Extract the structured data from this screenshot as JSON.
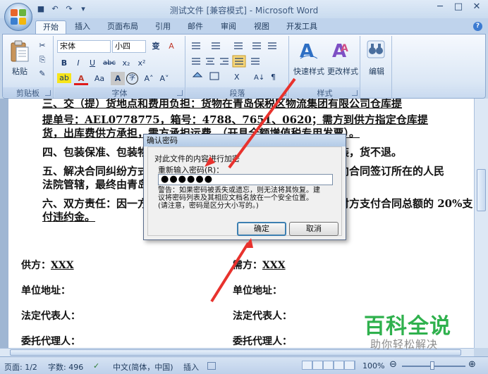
{
  "window": {
    "title": "测试文件 [兼容模式] - Microsoft Word",
    "minimize": "─",
    "maximize": "□",
    "close": "✕"
  },
  "qat": {
    "save": "■",
    "undo": "↶",
    "redo": "↷",
    "customize": "▾"
  },
  "tabs": [
    "开始",
    "插入",
    "页面布局",
    "引用",
    "邮件",
    "审阅",
    "视图",
    "开发工具"
  ],
  "help": "?",
  "ribbon": {
    "clipboard": {
      "label": "剪贴板",
      "paste": "粘贴",
      "cut": "✂",
      "copy": "⎘",
      "format_painter": "✎"
    },
    "font": {
      "label": "字体",
      "name": "宋体",
      "size": "小四",
      "phonetic": "变",
      "clear": "A",
      "bold": "B",
      "italic": "I",
      "underline": "U",
      "strike": "abc",
      "subscript": "x₂",
      "superscript": "x²",
      "change_case": "Aa",
      "highlight": "ab",
      "font_color": "A",
      "char_shade": "A",
      "enclose": "字",
      "grow": "A˄",
      "shrink": "A˅"
    },
    "paragraph": {
      "label": "段落"
    },
    "styles": {
      "label": "样式",
      "quick": "快速样式",
      "change": "更改样式"
    },
    "editing": {
      "label": "编辑"
    }
  },
  "document": {
    "lines": [
      {
        "text": "三、交（提）货地点和费用负担：货物在青岛保税区物流集团有限公司仓库提",
        "underline": true
      },
      {
        "text": "提单号：AEL0778775，箱号：4788、7651、0620；需方到供方指定仓库提",
        "underline": true
      },
      {
        "text": "货，出库费供方承担，需方承担运费。（开具全额增值税专用发票）。",
        "underline": true
      },
      {
        "text": "四、包装保准、包装物的供应与回收：按原产地包装，不另作包装，货不退。",
        "underline": false
      },
      {
        "text": "五、解决合同纠纷方式：双方协商解决，协商不成，任何一方可向合同签订所在的人民",
        "underline": false
      },
      {
        "text": "法院管辖，最终由青岛仲裁委员会仲裁。",
        "underline": false
      },
      {
        "text": "六、双方责任：因一方违约造成另一方经济损失的，违约方应向对方支付合同总额的 20%支",
        "underline": false
      },
      {
        "text": "付违约金。",
        "underline": true
      }
    ],
    "supplier_label": "供方：",
    "supplier_value": "XXX",
    "buyer_label": "需方：",
    "buyer_value": "XXX",
    "address_left": "单位地址：",
    "address_right": "单位地址：",
    "legal_left": "法定代表人：",
    "legal_right": "法定代表人：",
    "agent_left": "委托代理人：",
    "agent_right": "委托代理人："
  },
  "dialog": {
    "title": "确认密码",
    "description": "对此文件的内容进行加密",
    "field_label": "重新输入密码(R)：",
    "password": "●●●●●●",
    "warning_1": "警告：如果密码被丢失或遗忘，则无法将其恢复。建",
    "warning_2": "议将密码列表及其相应文档名放在一个安全位置。",
    "warning_3": "(请注意，密码是区分大小写的。)",
    "ok": "确定",
    "cancel": "取消"
  },
  "status": {
    "page": "页面: 1/2",
    "words": "字数: 496",
    "language": "中文(简体，中国)",
    "mode": "插入",
    "zoom": "100%"
  },
  "watermark": {
    "title": "百科全说",
    "subtitle": "助你轻松解决"
  },
  "colors": {
    "accent": "#3d7bd1",
    "arrow": "#e8322d",
    "watermark_green": "#2fb14d"
  }
}
